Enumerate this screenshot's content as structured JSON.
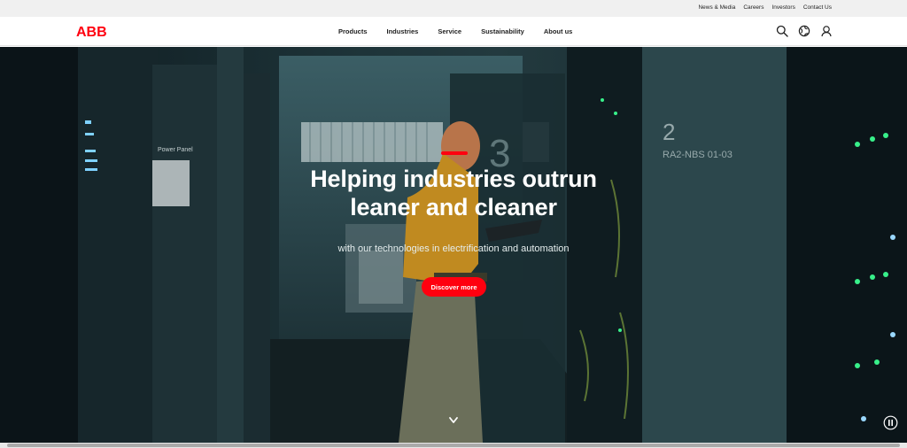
{
  "utility_nav": {
    "news_media": "News & Media",
    "careers": "Careers",
    "investors": "Investors",
    "contact": "Contact Us"
  },
  "brand": {
    "logo_text": "ABB",
    "color": "#ff000f"
  },
  "main_nav": {
    "products": "Products",
    "industries": "Industries",
    "service": "Service",
    "sustainability": "Sustainability",
    "about": "About us"
  },
  "nav_icons": [
    "search-icon",
    "globe-icon",
    "user-icon"
  ],
  "hero": {
    "title_line1": "Helping industries outrun",
    "title_line2": "leaner and cleaner",
    "subtitle": "with our technologies in electrification and automation",
    "cta_label": "Discover more",
    "accent_color": "#ff000f",
    "background_signs": {
      "power_panel": "Power Panel",
      "rack_number": "2",
      "rack_label": "RA2-NBS 01-03",
      "rack_number_alt": "3"
    }
  },
  "controls": {
    "scroll_icon": "chevron-down-icon",
    "pause_icon": "pause-icon"
  }
}
